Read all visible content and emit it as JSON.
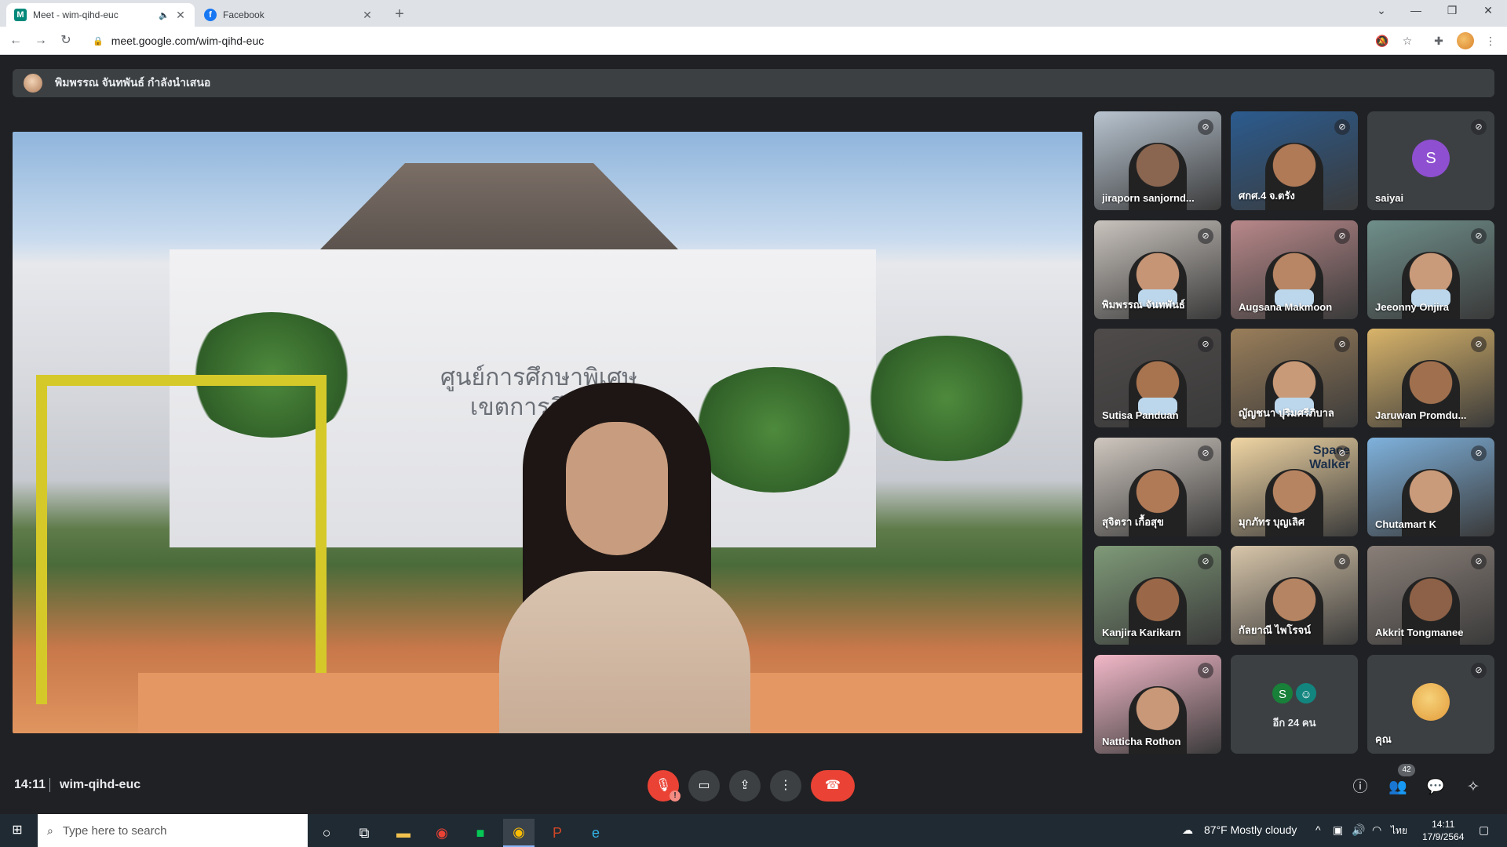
{
  "browser": {
    "tabs": [
      {
        "title": "Meet - wim-qihd-euc",
        "favicon": "meet-icon",
        "active": true,
        "audio_icon": "speaker-icon"
      },
      {
        "title": "Facebook",
        "favicon": "facebook-icon",
        "active": false
      }
    ],
    "url": "meet.google.com/wim-qihd-euc"
  },
  "meet": {
    "presenter_banner": "พิมพรรณ จันทพันธ์ กำลังนำเสนอ",
    "main_video_sign": "ศูนย์การศึกษาพิเศษ\nเขตการศึกษา",
    "tiles": [
      {
        "name": "jiraporn sanjornd...",
        "muted": true,
        "type": "video",
        "bg": "#b8c4d0",
        "skin": "#8a6650"
      },
      {
        "name": "ศกศ.4 จ.ตรัง",
        "muted": true,
        "type": "video",
        "bg": "#2b5b8f",
        "skin": "#b07a56"
      },
      {
        "name": "saiyai",
        "muted": true,
        "type": "avatar",
        "letter": "S",
        "avatar_color": "#8e4fd0"
      },
      {
        "name": "พิมพรรณ จันทพันธ์",
        "muted": true,
        "type": "video",
        "bg": "#c9c3bd",
        "skin": "#c69576",
        "mask": true
      },
      {
        "name": "Augsana Makmoon",
        "muted": true,
        "type": "video",
        "bg": "#b9888a",
        "skin": "#b88664",
        "mask": true
      },
      {
        "name": "Jeeonny Onjira",
        "muted": true,
        "type": "video",
        "bg": "#6f8f8a",
        "skin": "#c99b7a",
        "mask": true
      },
      {
        "name": "Sutisa Panduan",
        "muted": true,
        "type": "video",
        "bg": "#4f4b4a",
        "skin": "#a8734f",
        "mask": true
      },
      {
        "name": "ญัญชนา ปุริมศรีภิบาล",
        "muted": true,
        "type": "video",
        "bg": "#9a7e5a",
        "skin": "#c99a77",
        "mask": true
      },
      {
        "name": "Jaruwan Promdu...",
        "muted": true,
        "type": "video",
        "bg": "#d9b46a",
        "skin": "#a0704e"
      },
      {
        "name": "สุจิตรา เกื้อสุข",
        "muted": true,
        "type": "video",
        "bg": "#cfc7bf",
        "skin": "#b17a57"
      },
      {
        "name": "มุกภัทร บุญเลิศ",
        "muted": true,
        "type": "video",
        "bg": "#f1d6a4",
        "skin": "#b78462",
        "overlay_text": "Space\nWalker"
      },
      {
        "name": "Chutamart K",
        "muted": true,
        "type": "video",
        "bg": "#7fb2dd",
        "skin": "#c99b7a"
      },
      {
        "name": "Kanjira Karikarn",
        "muted": true,
        "type": "video",
        "bg": "#7f9a78",
        "skin": "#9a6848"
      },
      {
        "name": "กัลยาณี ไพโรจน์",
        "muted": true,
        "type": "video",
        "bg": "#d8c6aa",
        "skin": "#b58462"
      },
      {
        "name": "Akkrit Tongmanee",
        "muted": true,
        "type": "video",
        "bg": "#8a7f78",
        "skin": "#8d6147"
      },
      {
        "name": "Natticha Rothon",
        "muted": true,
        "type": "video",
        "bg": "#f2b8c8",
        "skin": "#c89878"
      },
      {
        "name": "อีก 24 คน",
        "muted": false,
        "type": "more",
        "avatars": [
          {
            "letter": "S",
            "color": "#188038"
          },
          {
            "letter": "☺",
            "color": "#12857f"
          }
        ]
      },
      {
        "name": "คุณ",
        "muted": true,
        "type": "self-avatar",
        "avatar_color": "#e39b3b"
      }
    ]
  },
  "controls": {
    "time": "14:11",
    "meeting_code": "wim-qihd-euc",
    "mic_alert": "!",
    "people_count": "42",
    "buttons": {
      "mic": "mic-off-icon",
      "camera": "camera-icon",
      "present": "present-icon",
      "more": "more-options-icon",
      "end_call": "end-call-icon"
    }
  },
  "taskbar": {
    "search_placeholder": "Type here to search",
    "weather": "87°F  Mostly cloudy",
    "language": "ไทย",
    "time": "14:11",
    "date": "17/9/2564"
  }
}
